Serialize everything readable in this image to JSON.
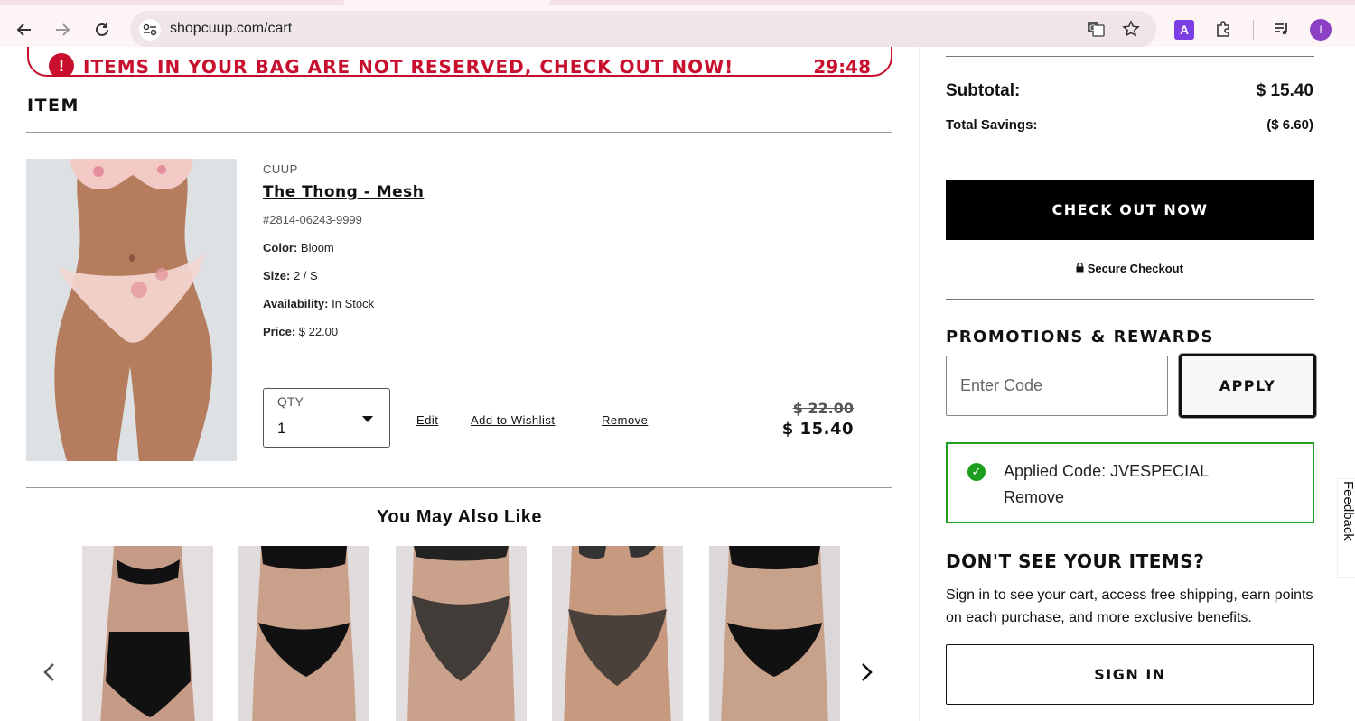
{
  "browser": {
    "url": "shopcuup.com/cart",
    "extension_letter": "A",
    "profile_initial": "I"
  },
  "banner": {
    "text": "ITEMS IN YOUR BAG ARE NOT RESERVED, CHECK OUT NOW!",
    "timer": "29:48",
    "color": "#c8102e"
  },
  "cart": {
    "heading": "ITEM",
    "item": {
      "brand": "CUUP",
      "name": "The Thong - Mesh",
      "sku": "#2814-06243-9999",
      "color_label": "Color:",
      "color_value": "Bloom",
      "size_label": "Size:",
      "size_value": "2 / S",
      "availability_label": "Availability:",
      "availability_value": "In Stock",
      "price_label": "Price:",
      "price_value": "$ 22.00",
      "qty_label": "QTY",
      "qty_value": "1",
      "edit": "Edit",
      "wishlist": "Add to Wishlist",
      "remove": "Remove",
      "original_price": "$ 22.00",
      "sale_price": "$ 15.40"
    }
  },
  "recommendations": {
    "title": "You May Also Like"
  },
  "summary": {
    "subtotal_label": "Subtotal:",
    "subtotal_value": "$ 15.40",
    "savings_label": "Total Savings:",
    "savings_value": "($ 6.60)",
    "checkout_label": "CHECK OUT NOW",
    "secure_label": "Secure Checkout"
  },
  "promotions": {
    "title": "PROMOTIONS & REWARDS",
    "code_placeholder": "Enter Code",
    "apply_label": "APPLY",
    "applied_text": "Applied Code: JVESPECIAL",
    "remove_label": "Remove",
    "success_color": "#1e9e1e"
  },
  "signin": {
    "title": "DON'T SEE YOUR ITEMS?",
    "text": "Sign in to see your cart, access free shipping, earn points on each purchase, and more exclusive benefits.",
    "button": "SIGN IN"
  },
  "feedback_label": "Feedback"
}
